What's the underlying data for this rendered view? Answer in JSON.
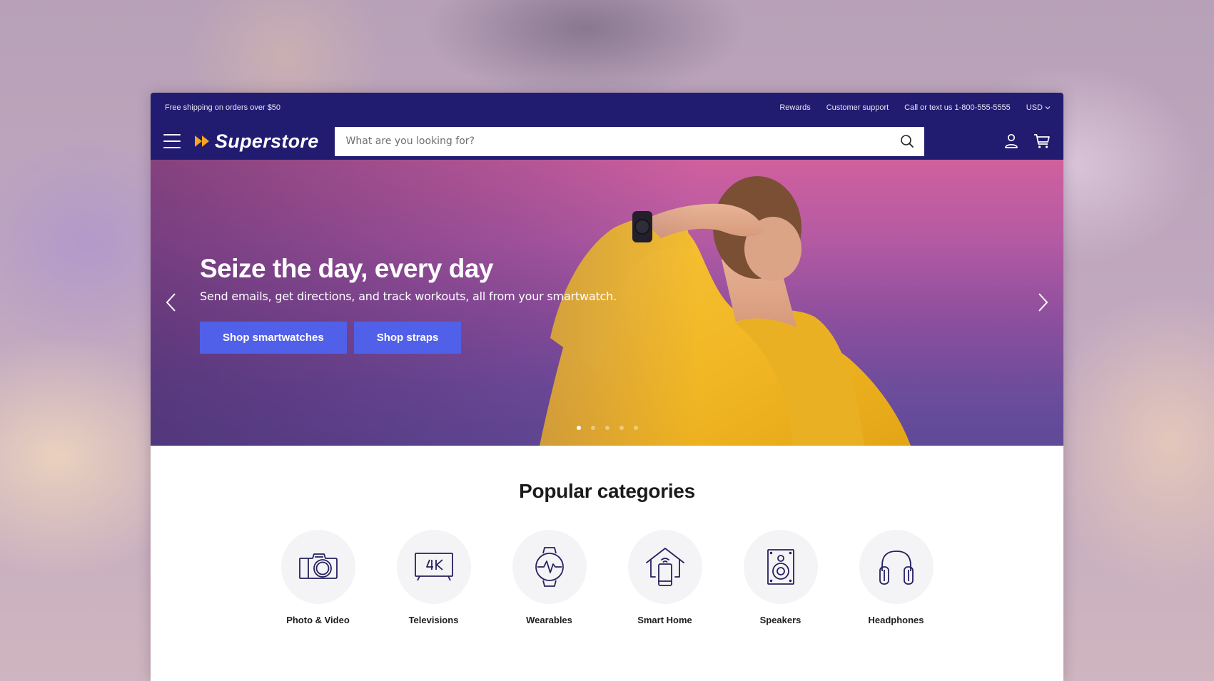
{
  "topbar": {
    "promo": "Free shipping on orders over $50",
    "links": [
      "Rewards",
      "Customer support",
      "Call or text us 1-800-555-5555"
    ],
    "currency": "USD"
  },
  "header": {
    "logo_text": "Superstore",
    "search_placeholder": "What are you looking for?",
    "icons": [
      "menu-icon",
      "search-icon",
      "account-icon",
      "cart-icon"
    ]
  },
  "hero": {
    "title": "Seize the day, every day",
    "subtitle": "Send emails, get directions, and track workouts, all from your smartwatch.",
    "buttons": [
      "Shop smartwatches",
      "Shop straps"
    ],
    "slide_count": 5,
    "active_slide": 1
  },
  "categories": {
    "title": "Popular categories",
    "items": [
      {
        "label": "Photo & Video",
        "icon": "camera-icon"
      },
      {
        "label": "Televisions",
        "icon": "tv-4k-icon"
      },
      {
        "label": "Wearables",
        "icon": "smartwatch-icon"
      },
      {
        "label": "Smart Home",
        "icon": "smart-home-icon"
      },
      {
        "label": "Speakers",
        "icon": "speaker-icon"
      },
      {
        "label": "Headphones",
        "icon": "headphones-icon"
      }
    ]
  },
  "colors": {
    "header_bg": "#211c70",
    "button_bg": "#5160e8",
    "logo_accent": "#f5a623",
    "icon_stroke": "#25205e"
  }
}
